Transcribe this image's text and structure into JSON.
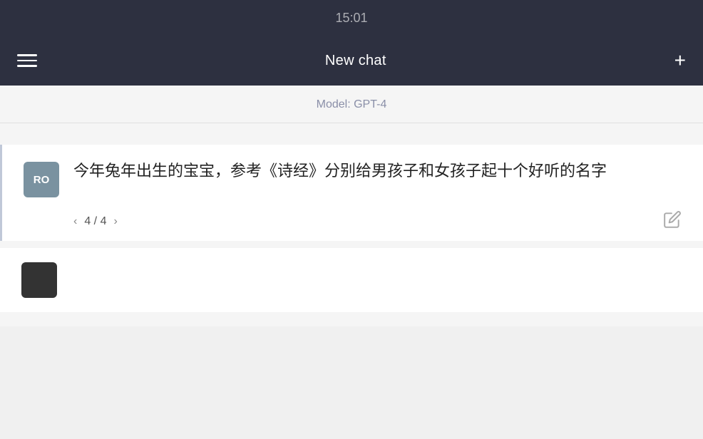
{
  "topbar": {
    "time_partial": "15:01"
  },
  "header": {
    "title": "New chat",
    "menu_icon_label": "menu",
    "plus_icon_label": "+"
  },
  "model_bar": {
    "label": "Model: GPT-4"
  },
  "chat_message": {
    "avatar_initials": "RO",
    "text": "今年兔年出生的宝宝，参考《诗经》分别给男孩子和女孩子起十个好听的名字",
    "pagination": {
      "current": 4,
      "total": 4
    },
    "edit_icon": "edit"
  },
  "colors": {
    "header_bg": "#2d3040",
    "avatar_bg": "#7a92a0",
    "model_text": "#8a8fa8",
    "border_left": "#c0c8d8"
  }
}
